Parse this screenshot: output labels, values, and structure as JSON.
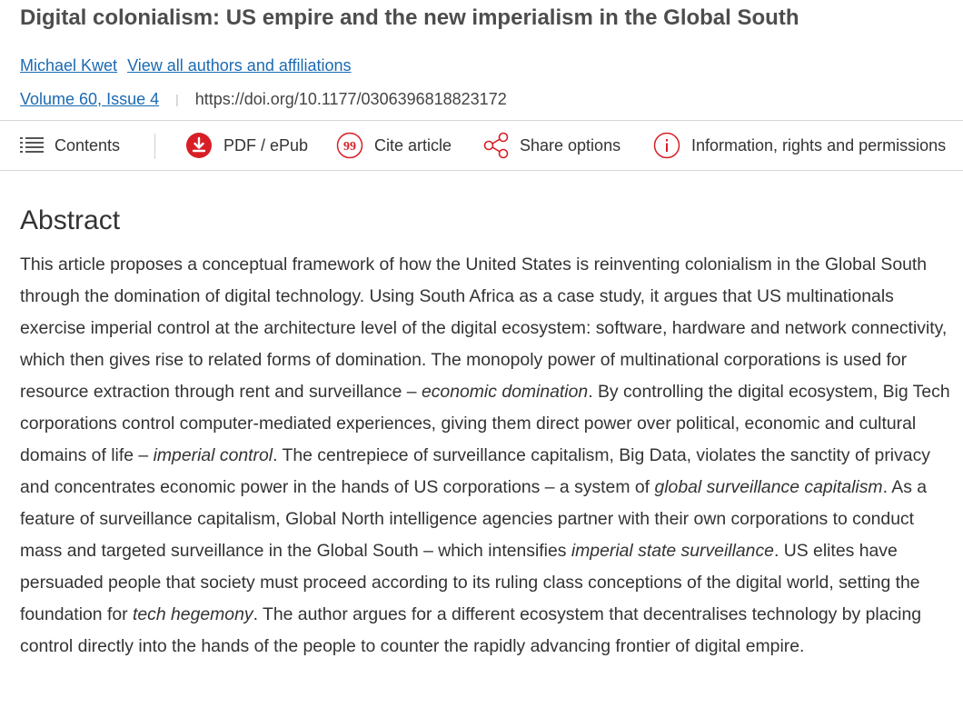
{
  "article": {
    "title": "Digital colonialism: US empire and the new imperialism in the Global South",
    "author": "Michael Kwet",
    "all_authors_link": "View all authors and affiliations",
    "volume_issue": "Volume 60, Issue 4",
    "separator": "|",
    "doi": "https://doi.org/10.1177/0306396818823172"
  },
  "toolbar": {
    "contents": "Contents",
    "pdf": "PDF / ePub",
    "cite": "Cite article",
    "share": "Share options",
    "info": "Information, rights and permissions"
  },
  "icons": {
    "contents": "list-icon",
    "pdf": "download-icon",
    "cite": "quote-icon",
    "share": "share-icon",
    "info": "info-icon"
  },
  "colors": {
    "link": "#1b6ab2",
    "accent": "#d81f26"
  },
  "abstract": {
    "heading": "Abstract",
    "s1": "This article proposes a conceptual framework of how the United States is reinventing colonialism in the Global South through the domination of digital technology. Using South Africa as a case study, it argues that US multinationals exercise imperial control at the architecture level of the digital ecosystem: software, hardware and network connectivity, which then gives rise to related forms of domination. The monopoly power of multinational corporations is used for resource extraction through rent and surveillance – ",
    "em1": "economic domination",
    "s2": ". By controlling the digital ecosystem, Big Tech corporations control computer-mediated experiences, giving them direct power over political, economic and cultural domains of life – ",
    "em2": "imperial control",
    "s3": ". The centrepiece of surveillance capitalism, Big Data, violates the sanctity of privacy and concentrates economic power in the hands of US corporations – a system of ",
    "em3": "global surveillance capitalism",
    "s4": ". As a feature of surveillance capitalism, Global North intelligence agencies partner with their own corporations to conduct mass and targeted surveillance in the Global South – which intensifies ",
    "em4": "imperial state surveillance",
    "s5": ". US elites have persuaded people that society must proceed according to its ruling class conceptions of the digital world, setting the foundation for ",
    "em5": "tech hegemony",
    "s6": ". The author argues for a different ecosystem that decentralises technology by placing control directly into the hands of the people to counter the rapidly advancing frontier of digital empire."
  }
}
